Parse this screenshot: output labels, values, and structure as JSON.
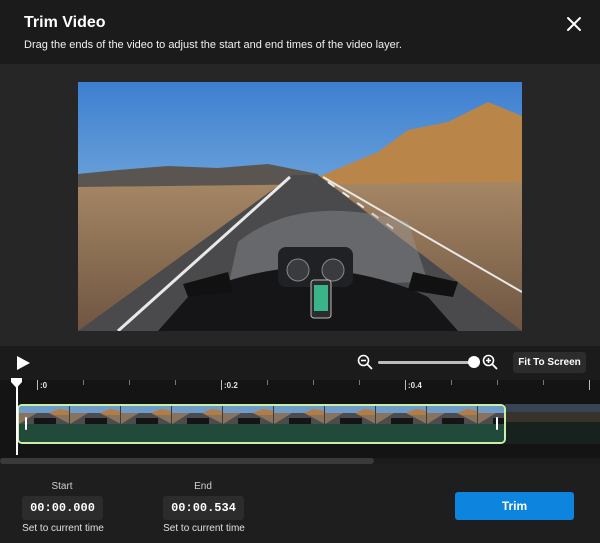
{
  "dialog": {
    "title": "Trim Video",
    "subtitle": "Drag the ends of the video to adjust the start and end times of the video layer."
  },
  "icons": {
    "close": "close-icon",
    "play": "play-icon",
    "zoom_out": "zoom-out-icon",
    "zoom_in": "zoom-in-icon"
  },
  "controls": {
    "fit_to_screen_label": "Fit To Screen",
    "zoom_level": 0.95
  },
  "timeline": {
    "ticks": [
      ":0",
      ":0.2",
      ":0.4"
    ]
  },
  "footer": {
    "start_label": "Start",
    "start_time": "00:00.000",
    "start_set_label": "Set to current time",
    "end_label": "End",
    "end_time": "00:00.534",
    "end_set_label": "Set to current time",
    "trim_label": "Trim"
  },
  "colors": {
    "accent": "#0d85de",
    "clip_border": "#c8f0a8",
    "clip_fill": "#224a3a"
  }
}
